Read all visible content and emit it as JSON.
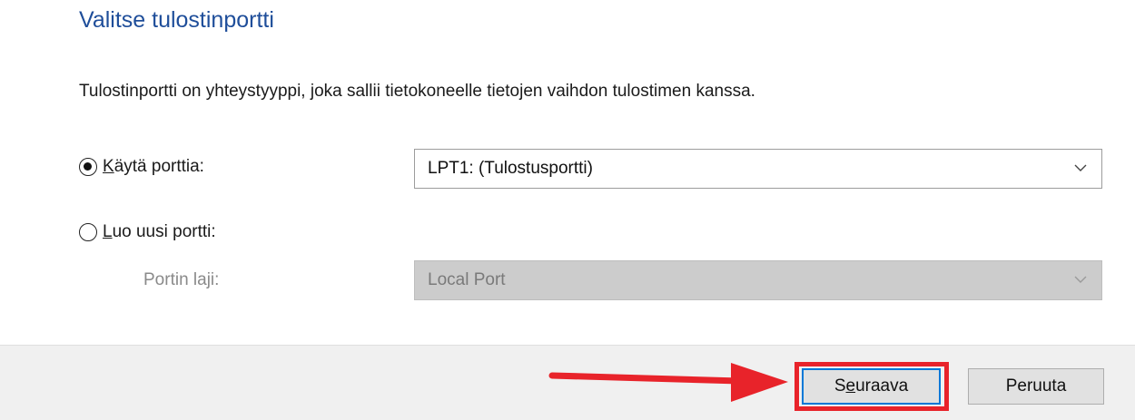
{
  "wizard": {
    "title": "Valitse tulostinportti",
    "description": "Tulostinportti on yhteystyyppi, joka sallii tietokoneelle tietojen vaihdon tulostimen kanssa."
  },
  "options": {
    "use_existing": {
      "accel": "K",
      "rest": "äytä porttia:",
      "checked": true,
      "selected_port": "LPT1: (Tulostusportti)"
    },
    "create_new": {
      "accel": "L",
      "rest": "uo uusi portti:",
      "checked": false,
      "port_type_label": "Portin laji:",
      "port_type_value": "Local Port",
      "port_type_enabled": false
    }
  },
  "buttons": {
    "next": {
      "accel": "e",
      "pre": "S",
      "post": "uraava"
    },
    "cancel": {
      "label": "Peruuta"
    }
  },
  "annotation": {
    "color": "#e8232a",
    "target": "next-button"
  },
  "colors": {
    "title": "#1f4e9a",
    "accent_border": "#1565c0",
    "focus_border": "#0078d7",
    "footer_bg": "#f0f0f0",
    "disabled_field_bg": "#cccccc"
  },
  "icons": {
    "dropdown": "chevron-down-icon",
    "radio_selected": "radio-checked-icon",
    "radio_unselected": "radio-unchecked-icon"
  }
}
